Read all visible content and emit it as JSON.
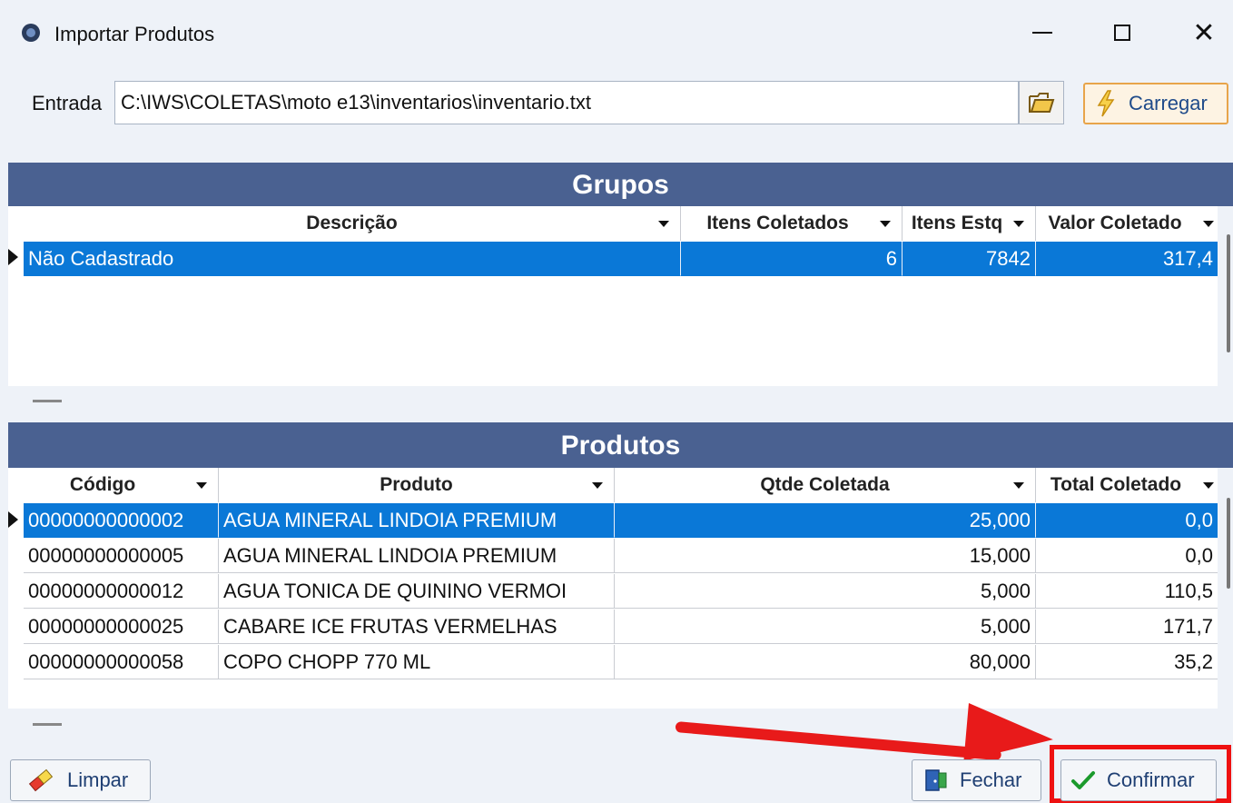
{
  "window": {
    "title": "Importar Produtos"
  },
  "entrada": {
    "label": "Entrada",
    "value": "C:\\IWS\\COLETAS\\moto e13\\inventarios\\inventario.txt",
    "load_button": "Carregar"
  },
  "grupos": {
    "title": "Grupos",
    "columns": [
      "Descrição",
      "Itens Coletados",
      "Itens Estq",
      "Valor Coletado"
    ],
    "rows": [
      [
        "Não Cadastrado",
        "6",
        "7842",
        "317,4"
      ]
    ]
  },
  "produtos": {
    "title": "Produtos",
    "columns": [
      "Código",
      "Produto",
      "Qtde Coletada",
      "Total Coletado"
    ],
    "rows": [
      [
        "00000000000002",
        "AGUA MINERAL LINDOIA PREMIUM",
        "25,000",
        "0,0"
      ],
      [
        "00000000000005",
        "AGUA MINERAL LINDOIA PREMIUM",
        "15,000",
        "0,0"
      ],
      [
        "00000000000012",
        "AGUA TONICA DE QUININO VERMOI",
        "5,000",
        "110,5"
      ],
      [
        "00000000000025",
        "CABARE ICE FRUTAS VERMELHAS",
        "5,000",
        "171,7"
      ],
      [
        "00000000000058",
        "COPO CHOPP 770 ML",
        "80,000",
        "35,2"
      ]
    ]
  },
  "footer": {
    "clear_button": "Limpar",
    "close_button": "Fechar",
    "confirm_button": "Confirmar"
  },
  "colors": {
    "header_band": "#4a6191",
    "selection": "#0a78d7",
    "highlight": "#ee1111"
  }
}
